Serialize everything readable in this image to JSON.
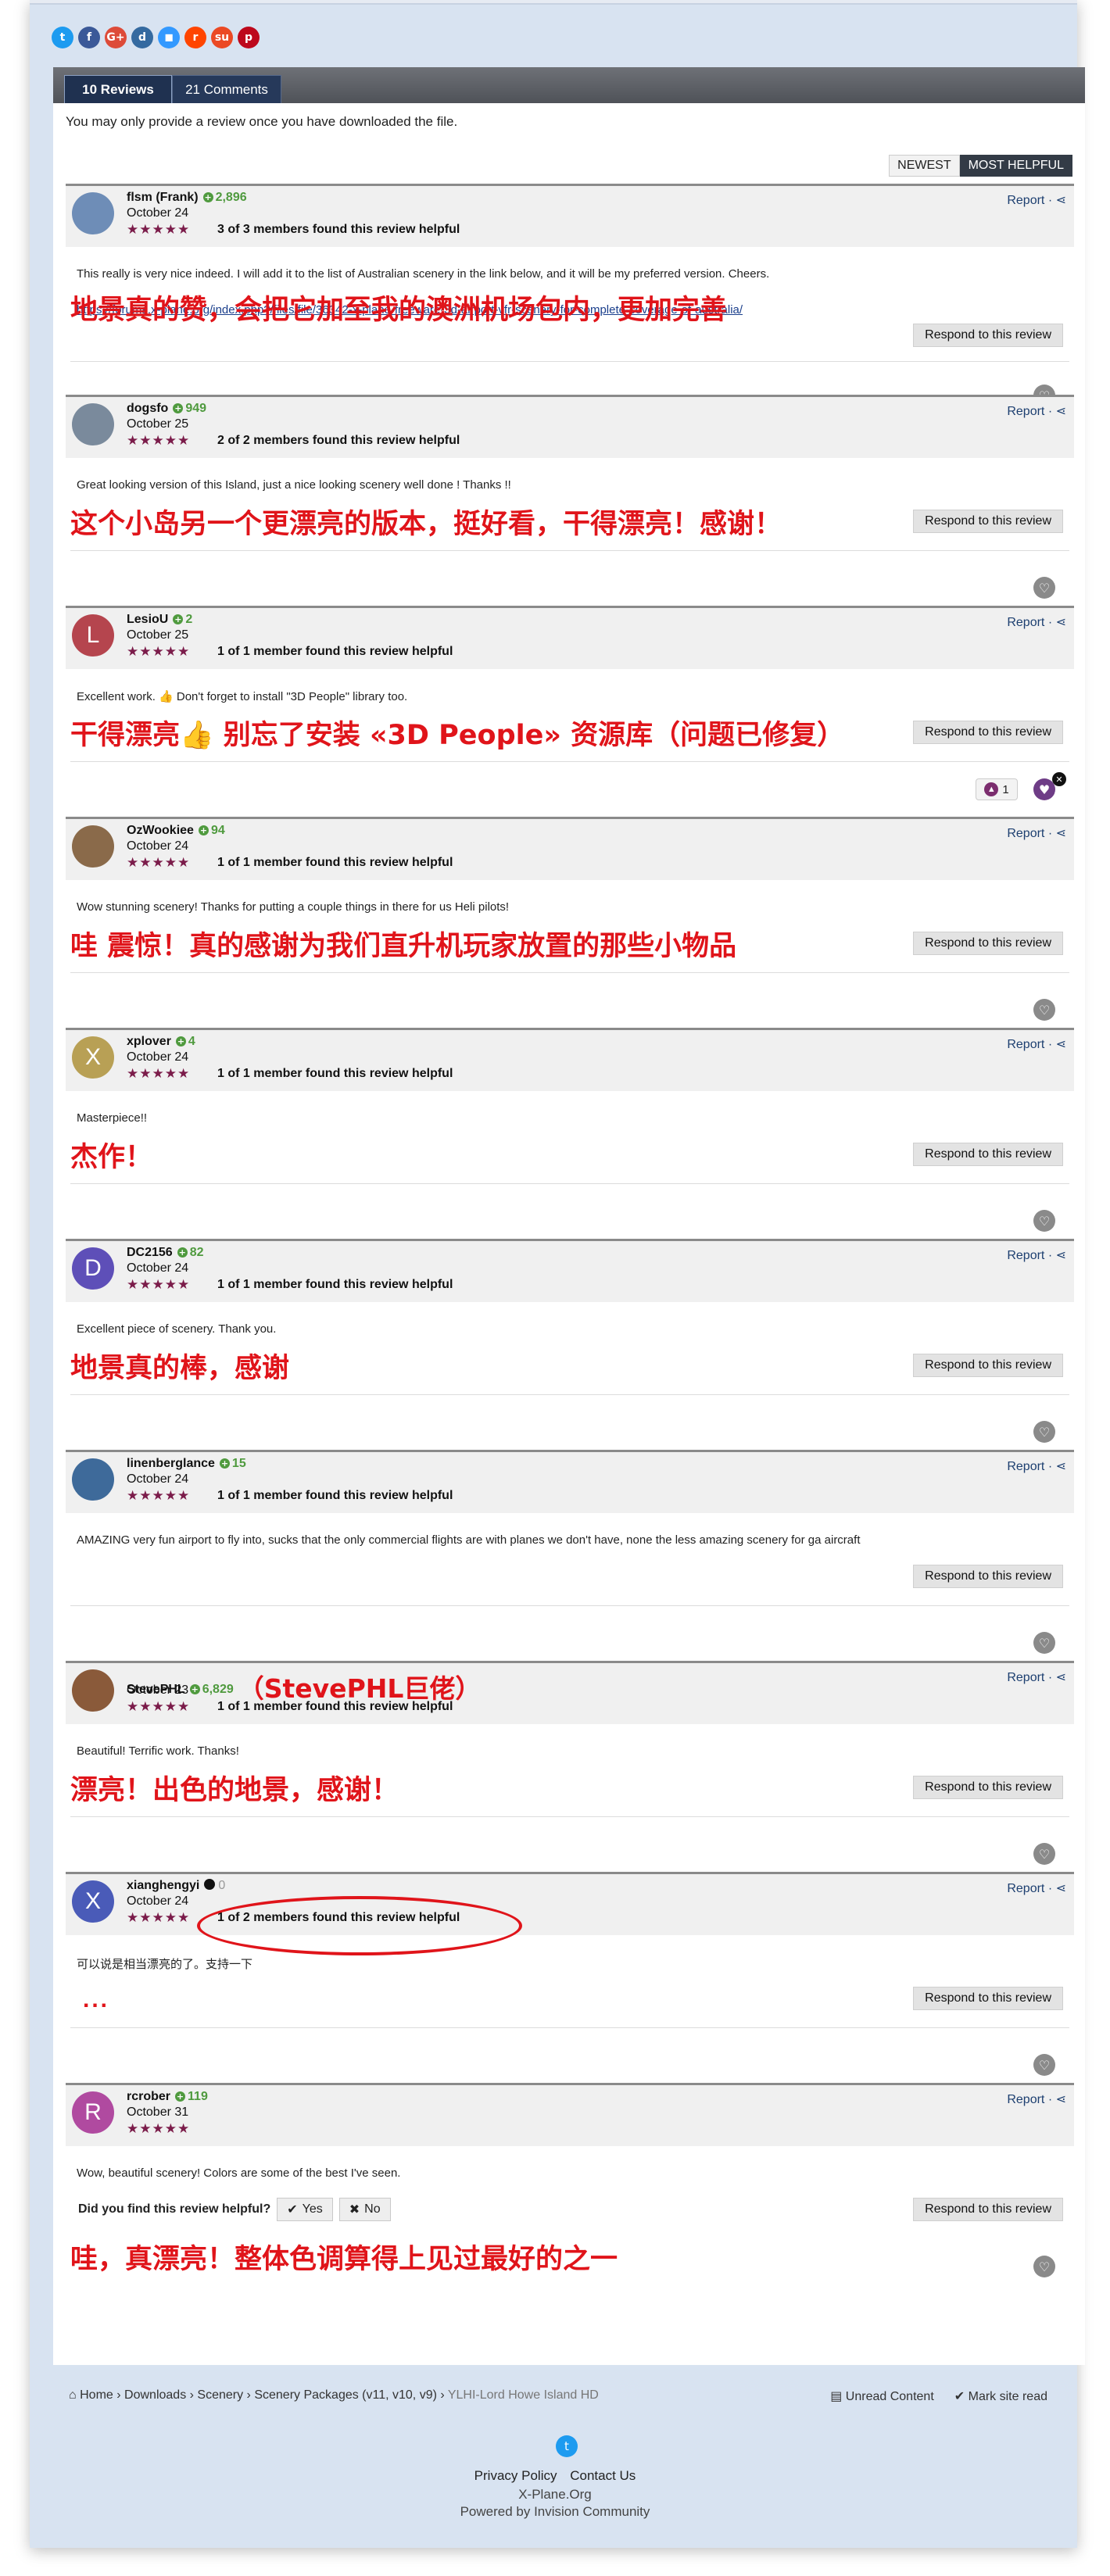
{
  "share_icons": [
    {
      "name": "twitter-icon",
      "glyph": "t",
      "color": "#1d9bf0"
    },
    {
      "name": "facebook-icon",
      "glyph": "f",
      "color": "#3b5998"
    },
    {
      "name": "google-plus-icon",
      "glyph": "G+",
      "color": "#dd4b39"
    },
    {
      "name": "digg-icon",
      "glyph": "d",
      "color": "#356aa0"
    },
    {
      "name": "delicious-icon",
      "glyph": "◼",
      "color": "#3399ff"
    },
    {
      "name": "reddit-icon",
      "glyph": "r",
      "color": "#ff4500"
    },
    {
      "name": "stumbleupon-icon",
      "glyph": "su",
      "color": "#eb4924"
    },
    {
      "name": "pinterest-icon",
      "glyph": "p",
      "color": "#bd081c"
    }
  ],
  "tabs": {
    "reviews": "10 Reviews",
    "comments": "21 Comments"
  },
  "notice": "You may only provide a review once you have downloaded the file.",
  "sort": {
    "newest": "NEWEST",
    "most_helpful": "MOST HELPFUL"
  },
  "labels": {
    "report": "Report",
    "respond": "Respond to this review",
    "vote_q": "Did you find this review helpful?",
    "yes": "Yes",
    "no": "No"
  },
  "reviews": [
    {
      "user": "flsm (Frank)",
      "rep": "2,896",
      "date": "October 24",
      "rating": 5,
      "helpful": "3 of 3 members found this review helpful",
      "text": "This really is very nice indeed.  I will add it to the list of Australian scenery in the link below, and it will be my preferred version.  Cheers.",
      "link": "https://forums.x-plane.org/index.php?/files/file/36342-x-plane-freeware-3d-airport-vfr-scenery-for-complete-coverage-of-australia/",
      "annotation": "地景真的赞，会把它加至我的澳洲机场包内，更加完善",
      "avatar": "",
      "avatar_color": "#6e8db7"
    },
    {
      "user": "dogsfo",
      "rep": "949",
      "date": "October 25",
      "rating": 5,
      "helpful": "2 of 2 members found this review helpful",
      "text": "Great looking version of this Island, just a nice looking scenery well done ! Thanks !!",
      "annotation": "这个小岛另一个更漂亮的版本，挺好看，干得漂亮！感谢！",
      "avatar": "",
      "avatar_color": "#7a8a9c"
    },
    {
      "user": "LesioU",
      "rep": "2",
      "date": "October 25",
      "rating": 5,
      "helpful": "1 of 1 member found this review helpful",
      "text": "Excellent work. 👍 Don't forget to install \"3D People\" library too.",
      "annotation": "干得漂亮👍 别忘了安装 «3D People» 资源库（问题已修复）",
      "avatar": "L",
      "avatar_color": "#b5454e",
      "reaction_count": "1"
    },
    {
      "user": "OzWookiee",
      "rep": "94",
      "date": "October 24",
      "rating": 5,
      "helpful": "1 of 1 member found this review helpful",
      "text": "Wow stunning scenery! Thanks for putting a couple things in there for us Heli pilots!",
      "annotation": "哇 震惊！真的感谢为我们直升机玩家放置的那些小物品",
      "avatar": "",
      "avatar_color": "#8a6a4a"
    },
    {
      "user": "xplover",
      "rep": "4",
      "date": "October 24",
      "rating": 5,
      "helpful": "1 of 1 member found this review helpful",
      "text": "Masterpiece!!",
      "annotation": "杰作！",
      "avatar": "X",
      "avatar_color": "#b8a055"
    },
    {
      "user": "DC2156",
      "rep": "82",
      "date": "October 24",
      "rating": 5,
      "helpful": "1 of 1 member found this review helpful",
      "text": "Excellent piece of scenery.  Thank you.",
      "annotation": "地景真的棒，感谢",
      "avatar": "D",
      "avatar_color": "#5e4fb8"
    },
    {
      "user": "linenberglance",
      "rep": "15",
      "date": "October 24",
      "rating": 5,
      "helpful": "1 of 1 member found this review helpful",
      "text": "AMAZING very fun airport to fly into, sucks that the only commercial flights are with planes we don't have, none the less amazing scenery for ga aircraft",
      "annotation": "",
      "avatar": "",
      "avatar_color": "#3e6a9a"
    },
    {
      "user": "StevePHL",
      "rep": "6,829",
      "date": "October 23",
      "rating": 5,
      "helpful": "1 of 1 member found this review helpful",
      "text": "Beautiful!  Terrific work.  Thanks!",
      "annotation": "漂亮！出色的地景，感谢！",
      "name_note": "（StevePHL巨佬）",
      "avatar": "",
      "avatar_color": "#8a5a3a"
    },
    {
      "user": "xianghengyi",
      "rep": "0",
      "date": "October 24",
      "rating": 5,
      "helpful": "1 of 2 members found this review helpful",
      "text": "可以说是相当漂亮的了。支持一下",
      "annotation": "...",
      "avatar": "X",
      "avatar_color": "#4a5bb8"
    },
    {
      "user": "rcrober",
      "rep": "119",
      "date": "October 31",
      "rating": 5,
      "helpful": "",
      "text": "Wow, beautiful scenery! Colors are some of the best I've seen.",
      "annotation": "哇，真漂亮！整体色调算得上见过最好的之一",
      "avatar": "R",
      "avatar_color": "#b04aa0"
    }
  ],
  "breadcrumb": {
    "home": "Home",
    "downloads": "Downloads",
    "scenery": "Scenery",
    "packages": "Scenery Packages (v11, v10, v9)",
    "current": "YLHI-Lord Howe Island HD"
  },
  "footer_actions": {
    "unread": "Unread Content",
    "mark_read": "Mark site read"
  },
  "footer": {
    "privacy": "Privacy Policy",
    "contact": "Contact Us",
    "site": "X-Plane.Org",
    "powered": "Powered by Invision Community"
  }
}
